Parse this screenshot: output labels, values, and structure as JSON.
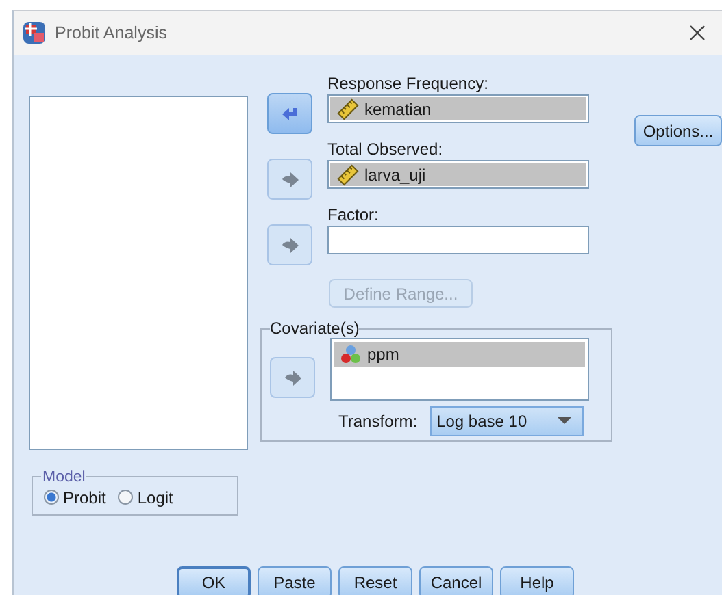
{
  "window": {
    "title": "Probit Analysis"
  },
  "targets": [
    {
      "label": "Response Frequency:",
      "arrow": {
        "kind": "left",
        "enabled": true
      },
      "value": "kematian",
      "kind": "scale"
    },
    {
      "label": "Total Observed:",
      "arrow": {
        "kind": "right",
        "enabled": false
      },
      "value": "larva_uji",
      "kind": "scale"
    },
    {
      "label": "Factor:",
      "arrow": {
        "kind": "right",
        "enabled": false
      }
    }
  ],
  "define_range": {
    "label": "Define Range...",
    "disabled": true
  },
  "covariates": {
    "title": "Covariate(s)",
    "arrow": {
      "kind": "right",
      "enabled": false
    },
    "items": [
      {
        "label": "ppm",
        "kind": "nominal",
        "selected": true
      }
    ],
    "transform_label": "Transform:",
    "transform_value": "Log base 10"
  },
  "options_button": "Options...",
  "model": {
    "title": "Model",
    "options": [
      {
        "label": "Probit",
        "selected": true
      },
      {
        "label": "Logit",
        "selected": false
      }
    ]
  },
  "buttons": [
    {
      "label": "OK",
      "default": true
    },
    {
      "label": "Paste",
      "default": false
    },
    {
      "label": "Reset",
      "default": false
    },
    {
      "label": "Cancel",
      "default": false
    },
    {
      "label": "Help",
      "default": false
    }
  ]
}
